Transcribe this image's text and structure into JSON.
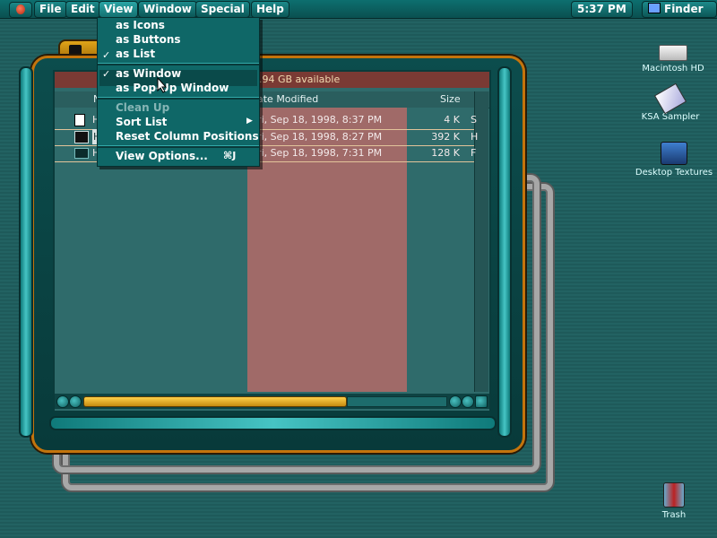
{
  "menubar": {
    "items": [
      "File",
      "Edit",
      "View",
      "Window",
      "Special",
      "Help"
    ],
    "clock": "5:37 PM",
    "app": "Finder"
  },
  "view_menu": {
    "items": [
      {
        "label": "as Icons",
        "checked": false
      },
      {
        "label": "as Buttons",
        "checked": false
      },
      {
        "label": "as List",
        "checked": true
      },
      {
        "label": "as Window",
        "checked": true
      },
      {
        "label": "as Pop-Up Window",
        "checked": false
      },
      {
        "label": "Clean Up",
        "disabled": true
      },
      {
        "label": "Sort List",
        "submenu": true
      },
      {
        "label": "Reset Column Positions"
      },
      {
        "label": "View Options...",
        "shortcut": "⌘J"
      }
    ],
    "check_mark": "✓",
    "submenu_arrow": "▶"
  },
  "window": {
    "available": ".94 GB available",
    "columns": {
      "name_fragment": "N",
      "date": "ate Modified",
      "size": "Size"
    },
    "rows": [
      {
        "name": "H",
        "date": "ri, Sep 18, 1998, 8:37 PM",
        "size": "4 K",
        "kind": "S"
      },
      {
        "name": "H",
        "date": "ri, Sep 18, 1998, 8:27 PM",
        "size": "392 K",
        "kind": "H"
      },
      {
        "name": "H",
        "date": "ri, Sep 18, 1998, 7:31 PM",
        "size": "128 K",
        "kind": "F"
      }
    ]
  },
  "desktop": {
    "icons": [
      "Macintosh HD",
      "KSA Sampler",
      "Desktop Textures",
      "Trash"
    ]
  },
  "colors": {
    "accent": "#c4740c",
    "menu": "#0f6767",
    "date_column": "#a06a68"
  }
}
